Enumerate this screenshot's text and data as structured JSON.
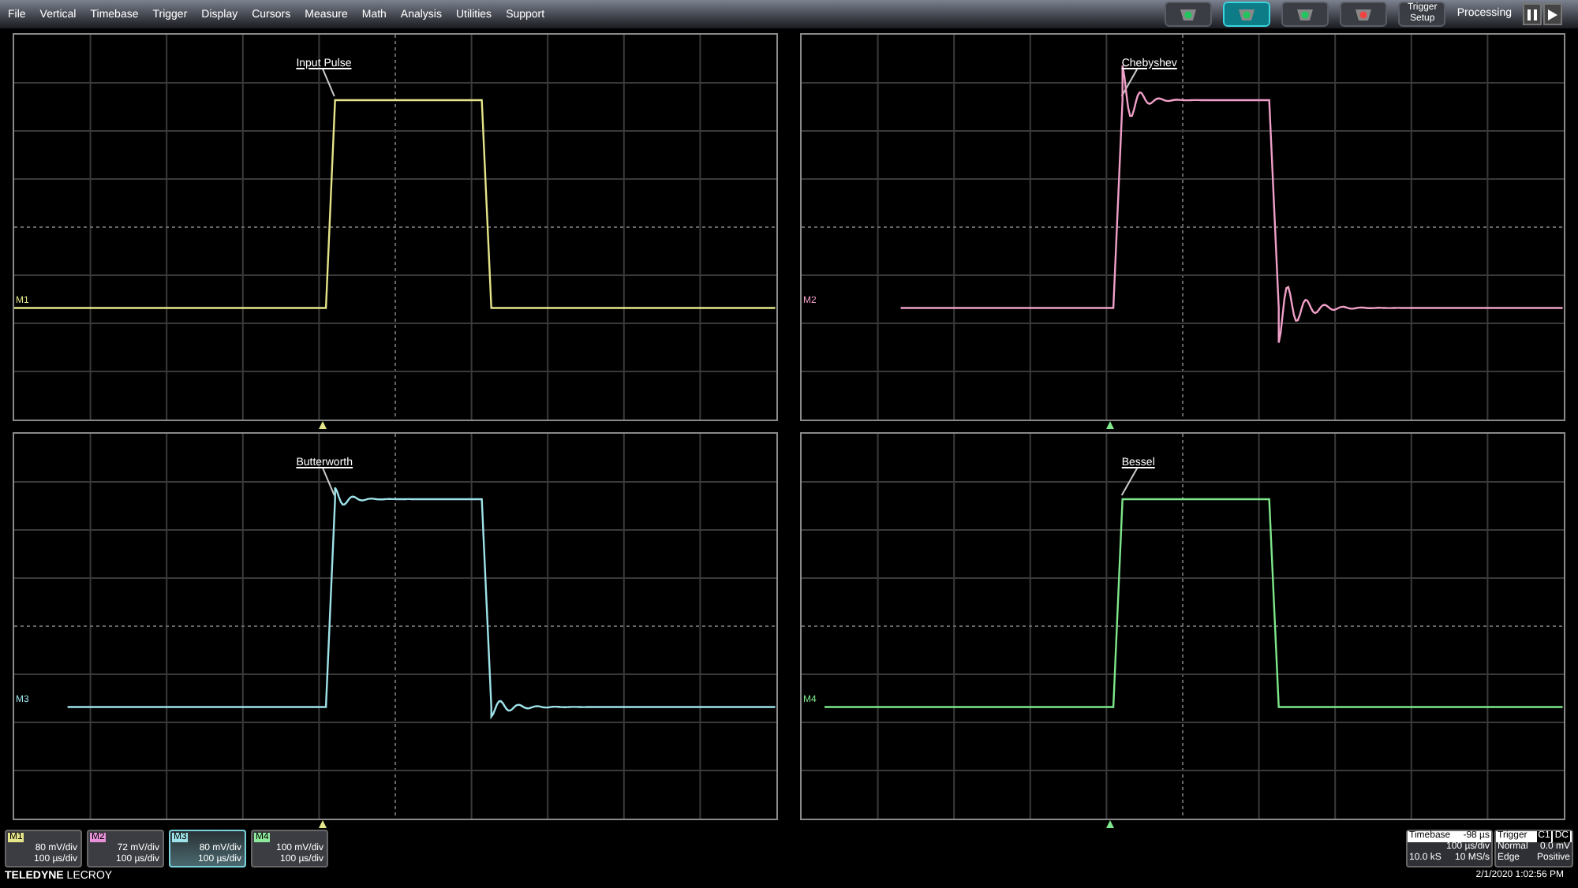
{
  "menu": [
    "File",
    "Vertical",
    "Timebase",
    "Trigger",
    "Display",
    "Cursors",
    "Measure",
    "Math",
    "Analysis",
    "Utilities",
    "Support"
  ],
  "trigger_modes": [
    {
      "color": "#22c55e",
      "selected": false
    },
    {
      "color": "#22c55e",
      "selected": true
    },
    {
      "color": "#22c55e",
      "selected": false
    },
    {
      "color": "#ef4444",
      "selected": false
    }
  ],
  "trigger_setup": "Trigger Setup",
  "processing": "Processing",
  "panels": [
    {
      "channel": "M1",
      "annotation": "Input Pulse",
      "color": "#e5e58a"
    },
    {
      "channel": "M2",
      "annotation": "Chebyshev",
      "color": "#f0a0c8"
    },
    {
      "channel": "M3",
      "annotation": "Butterworth",
      "color": "#9fe3ea"
    },
    {
      "channel": "M4",
      "annotation": "Bessel",
      "color": "#7ee88a"
    }
  ],
  "descriptors": [
    {
      "label": "M1",
      "color": "#e5e58a",
      "scale": "80 mV/div",
      "timebase": "100 µs/div",
      "selected": false
    },
    {
      "label": "M2",
      "color": "#e890d8",
      "scale": "72 mV/div",
      "timebase": "100 µs/div",
      "selected": false
    },
    {
      "label": "M3",
      "color": "#9fe3ea",
      "scale": "80 mV/div",
      "timebase": "100 µs/div",
      "selected": true
    },
    {
      "label": "M4",
      "color": "#8ee89a",
      "scale": "100 mV/div",
      "timebase": "100 µs/div",
      "selected": false
    }
  ],
  "brand": {
    "bold": "TELEDYNE",
    "light": "LECROY"
  },
  "timebase": {
    "title": "Timebase",
    "delay": "-98 µs",
    "per_div": "100 µs/div",
    "samples": "10.0 kS",
    "rate": "10 MS/s"
  },
  "trigger": {
    "title": "Trigger",
    "source": "C1",
    "coupling": "DC",
    "mode": "Normal",
    "level": "0.0 mV",
    "type": "Edge",
    "slope": "Positive"
  },
  "timestamp": "2/1/2020 1:02:56 PM"
}
